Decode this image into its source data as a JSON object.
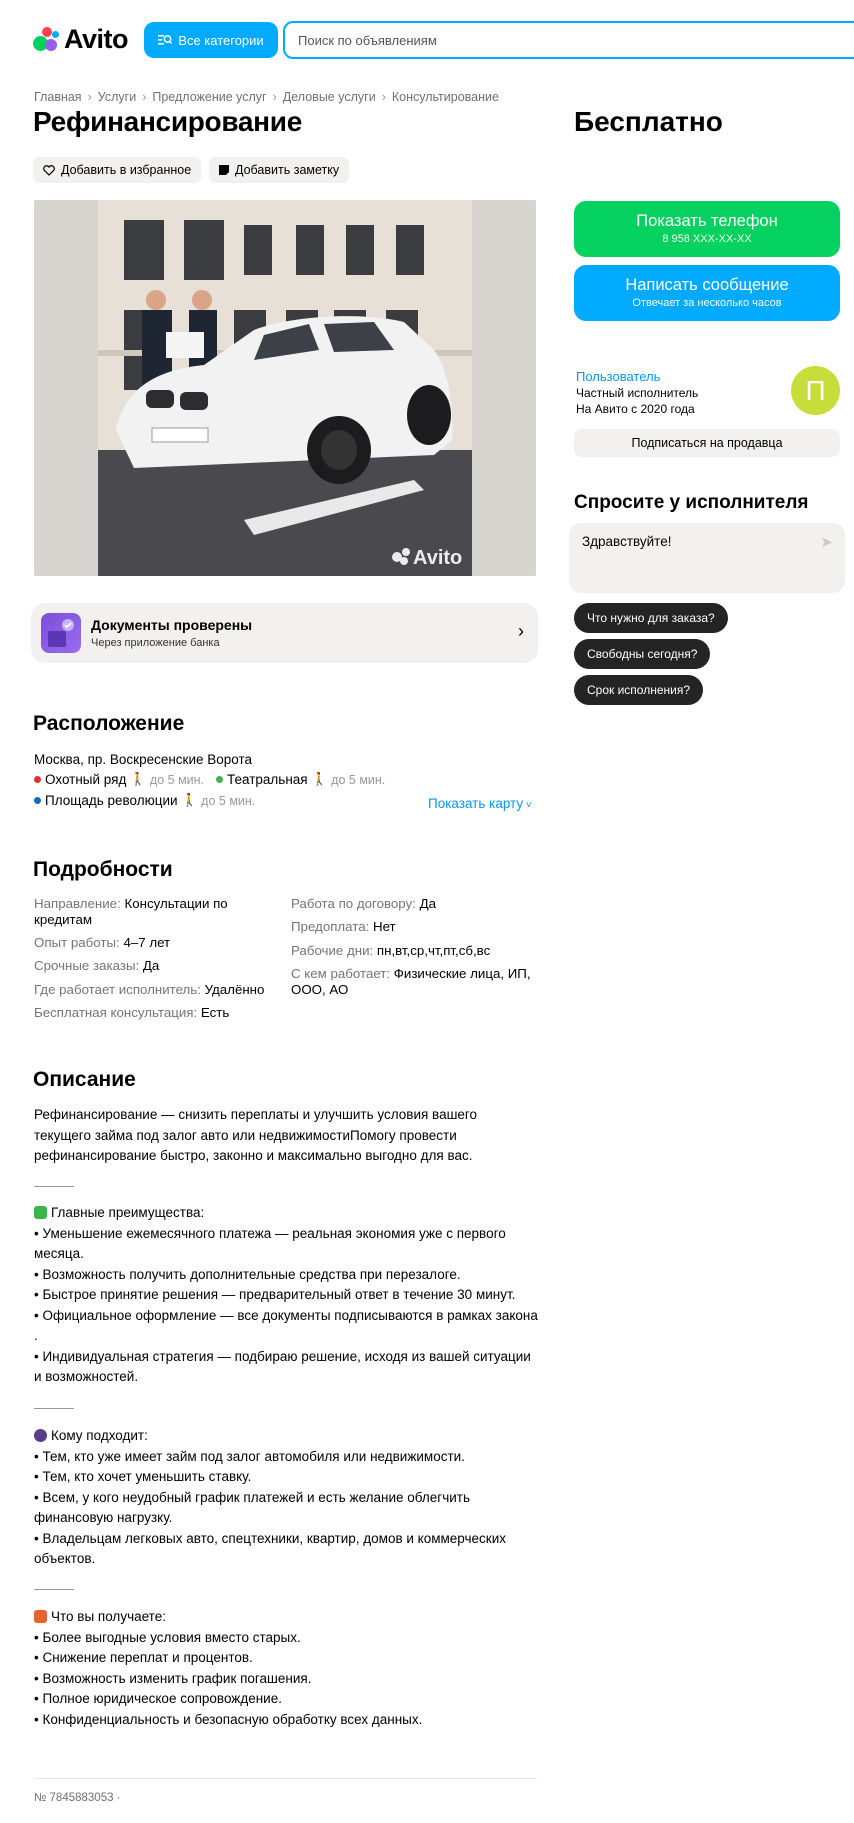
{
  "header": {
    "logo_text": "Avito",
    "categories_label": "Все категории",
    "search_placeholder": "Поиск по объявлениям"
  },
  "breadcrumb": [
    "Главная",
    "Услуги",
    "Предложение услуг",
    "Деловые услуги",
    "Консультирование"
  ],
  "listing": {
    "title": "Рефинансирование",
    "favorite_label": "Добавить в избранное",
    "note_label": "Добавить заметку",
    "watermark": "Avito",
    "docs_title": "Документы проверены",
    "docs_sub": "Через приложение банка"
  },
  "location": {
    "title": "Расположение",
    "address": "Москва, пр. Воскресенские Ворота",
    "stations": [
      {
        "name": "Охотный ряд",
        "time": "до 5 мин.",
        "color": "#e4312c"
      },
      {
        "name": "Театральная",
        "time": "до 5 мин.",
        "color": "#48ad4f"
      },
      {
        "name": "Площадь революции",
        "time": "до 5 мин.",
        "color": "#0a6dc0"
      }
    ],
    "show_map": "Показать карту"
  },
  "details": {
    "title": "Подробности",
    "left": [
      {
        "k": "Направление: ",
        "v": "Консультации по кредитам"
      },
      {
        "k": "Опыт работы: ",
        "v": "4–7 лет"
      },
      {
        "k": "Срочные заказы: ",
        "v": "Да"
      },
      {
        "k": "Где работает исполнитель: ",
        "v": "Удалённо"
      },
      {
        "k": "Бесплатная консультация: ",
        "v": "Есть"
      }
    ],
    "right": [
      {
        "k": "Работа по договору: ",
        "v": "Да"
      },
      {
        "k": "Предоплата: ",
        "v": "Нет"
      },
      {
        "k": "Рабочие дни: ",
        "v": "пн,вт,ср,чт,пт,сб,вс"
      },
      {
        "k": "С кем работает: ",
        "v": "Физические лица, ИП, ООО, АО"
      }
    ]
  },
  "description": {
    "title": "Описание",
    "intro": "Рефинансирование — снизить переплаты и улучшить условия вашего текущего займа под залог авто или недвижимостиПомогу провести рефинансирование быстро, законно и максимально выгодно для вас.",
    "adv_title": "Главные преимущества:",
    "adv": [
      "• Уменьшение ежемесячного платежа — реальная экономия уже с первого месяца.",
      "• Возможность получить дополнительные средства при перезалоге.",
      "• Быстрое принятие решения — предварительный ответ в течение 30 минут.",
      "• Официальное оформление — все документы подписываются в рамках закона .",
      "• Индивидуальная стратегия — подбираю решение, исходя из вашей ситуации и возможностей."
    ],
    "who_title": "Кому подходит:",
    "who": [
      "• Тем, кто уже имеет займ под залог автомобиля или недвижимости.",
      "• Тем, кто хочет уменьшить ставку.",
      "• Всем, у кого неудобный график платежей и есть желание облегчить финансовую нагрузку.",
      "• Владельцам легковых авто, спецтехники, квартир, домов и коммерческих объектов."
    ],
    "get_title": "Что вы получаете:",
    "get": [
      "• Более выгодные условия вместо старых.",
      "• Снижение переплат и процентов.",
      "• Возможность изменить график погашения.",
      "• Полное юридическое сопровождение.",
      "• Конфиденциальность и безопасную обработку всех данных."
    ]
  },
  "item_number": "№ 7845883053 ·",
  "sidebar": {
    "price": "Бесплатно",
    "phone_label": "Показать телефон",
    "phone_number": "8 958 XXX-XX-XX",
    "message_label": "Написать сообщение",
    "message_sub": "Отвечает за несколько часов",
    "seller_name": "Пользователь",
    "seller_type": "Частный исполнитель",
    "seller_since": "На Авито с 2020 года",
    "avatar_letter": "П",
    "subscribe_label": "Подписаться на продавца",
    "ask_title": "Спросите у исполнителя",
    "ask_text": "Здравствуйте!",
    "quick_replies": [
      "Что нужно для заказа?",
      "Свободны сегодня?",
      "Срок исполнения?"
    ]
  },
  "colors": {
    "accent": "#00aaff",
    "green": "#04d15f",
    "avatar": "#c7dd3a"
  }
}
